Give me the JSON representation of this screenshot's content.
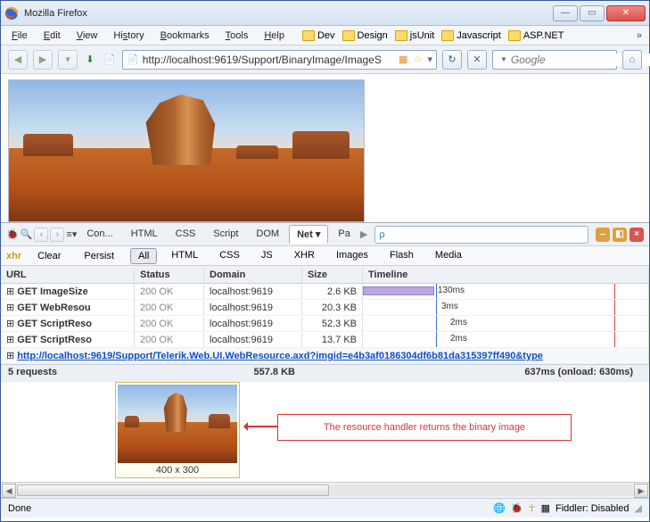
{
  "window": {
    "title": "Mozilla Firefox"
  },
  "menu": {
    "items": [
      "File",
      "Edit",
      "View",
      "History",
      "Bookmarks",
      "Tools",
      "Help"
    ],
    "bookmark_folders": [
      "Dev",
      "Design",
      "jsUnit",
      "Javascript",
      "ASP.NET"
    ]
  },
  "nav": {
    "url": "http://localhost:9619/Support/BinaryImage/ImageS",
    "search_placeholder": "Google"
  },
  "devtools": {
    "tabs": [
      "Con...",
      "HTML",
      "CSS",
      "Script",
      "DOM",
      "Net",
      "Pa"
    ],
    "active_tab": "Net",
    "filters_left": [
      "Clear",
      "Persist"
    ],
    "filters": [
      "All",
      "HTML",
      "CSS",
      "JS",
      "XHR",
      "Images",
      "Flash",
      "Media"
    ],
    "active_filter": "All",
    "xhr_label": "xhr",
    "columns": [
      "URL",
      "Status",
      "Domain",
      "Size",
      "Timeline"
    ],
    "rows": [
      {
        "method": "GET",
        "name": "ImageSize",
        "status": "200 OK",
        "domain": "localhost:9619",
        "size": "2.6 KB",
        "bar": {
          "left": 0,
          "width": 80
        },
        "label": "130ms"
      },
      {
        "method": "GET",
        "name": "WebResou",
        "status": "200 OK",
        "domain": "localhost:9619",
        "size": "20.3 KB",
        "bar": null,
        "label": "3ms",
        "label_left": 88
      },
      {
        "method": "GET",
        "name": "ScriptReso",
        "status": "200 OK",
        "domain": "localhost:9619",
        "size": "52.3 KB",
        "bar": null,
        "label": "2ms",
        "label_left": 98
      },
      {
        "method": "GET",
        "name": "ScriptReso",
        "status": "200 OK",
        "domain": "localhost:9619",
        "size": "13.7 KB",
        "bar": null,
        "label": "2ms",
        "label_left": 98
      }
    ],
    "link_row": "http://localhost:9619/Support/Telerik.Web.UI.WebResource.axd?imgid=e4b3af0186304df6b81da315397ff490&type",
    "summary": {
      "requests": "5 requests",
      "size": "557.8 KB",
      "time": "637ms (onload: 630ms)"
    }
  },
  "preview": {
    "caption": "400 x 300"
  },
  "annotation": {
    "text": "The resource handler returns the binary image"
  },
  "status": {
    "left": "Done",
    "fiddler": "Fiddler: Disabled"
  }
}
